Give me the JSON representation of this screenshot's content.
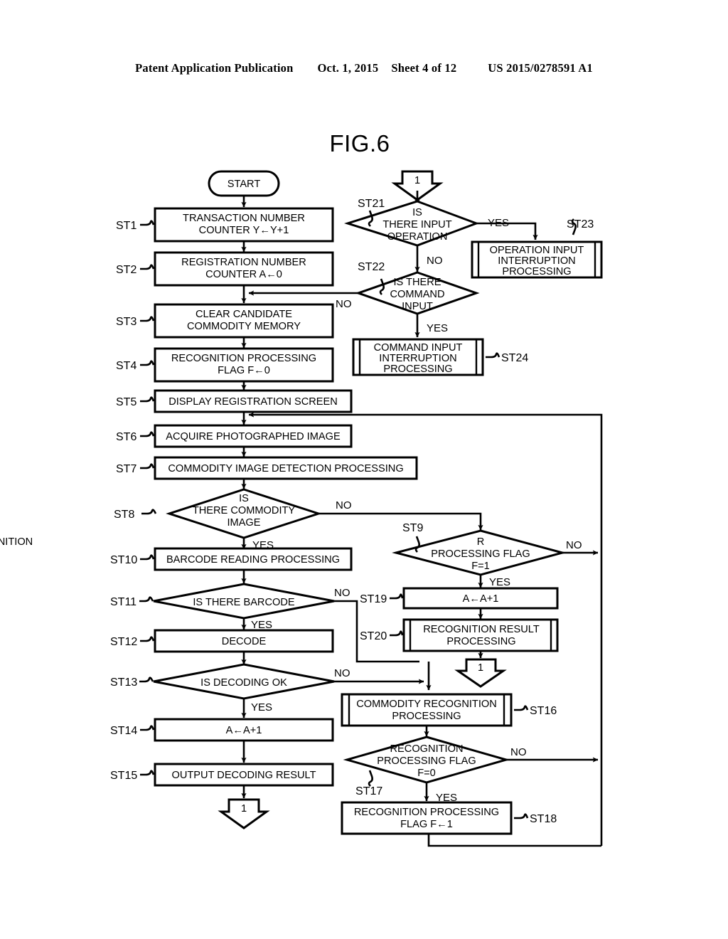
{
  "header": {
    "publication": "Patent Application Publication",
    "date": "Oct. 1, 2015",
    "sheet": "Sheet 4 of 12",
    "number": "US 2015/0278591 A1"
  },
  "figure": {
    "title": "FIG.6"
  },
  "nodes": {
    "start": "START",
    "st1": "TRANSACTION NUMBER\nCOUNTER Y←Y+1",
    "st1_l1": "TRANSACTION NUMBER",
    "st1_l2": "COUNTER Y←Y+1",
    "st2_l1": "REGISTRATION NUMBER",
    "st2_l2": "COUNTER A←0",
    "st3_l1": "CLEAR CANDIDATE",
    "st3_l2": "COMMODITY MEMORY",
    "st4_l1": "RECOGNITION PROCESSING",
    "st4_l2": "FLAG F←0",
    "st5": "DISPLAY REGISTRATION SCREEN",
    "st6": "ACQUIRE PHOTOGRAPHED IMAGE",
    "st7": "COMMODITY IMAGE DETECTION PROCESSING",
    "st8_l1": "IS",
    "st8_l2": "THERE COMMODITY",
    "st8_l3": "IMAGE",
    "st9_l1": "RECOGNITION",
    "st9_l2": "PROCESSING FLAG",
    "st9_l3": "F=1",
    "st10": "BARCODE READING PROCESSING",
    "st11": "IS THERE BARCODE",
    "st12": "DECODE",
    "st13": "IS DECODING OK",
    "st14": "A←A+1",
    "st15": "OUTPUT DECODING RESULT",
    "st16_l1": "COMMODITY RECOGNITION",
    "st16_l2": "PROCESSING",
    "st17_l1": "RECOGNITION",
    "st17_l2": "PROCESSING FLAG",
    "st17_l3": "F=0",
    "st18_l1": "RECOGNITION PROCESSING",
    "st18_l2": "FLAG F←1",
    "st19": "A←A+1",
    "st20_l1": "RECOGNITION RESULT",
    "st20_l2": "PROCESSING",
    "st21_l1": "IS",
    "st21_l2": "THERE INPUT",
    "st21_l3": "OPERATION",
    "st22_l1": "IS THERE",
    "st22_l2": "COMMAND",
    "st22_l3": "INPUT",
    "st23_l1": "OPERATION INPUT",
    "st23_l2": "INTERRUPTION",
    "st23_l3": "PROCESSING",
    "st24_l1": "COMMAND INPUT",
    "st24_l2": "INTERRUPTION",
    "st24_l3": "PROCESSING"
  },
  "step_labels": {
    "st1": "ST1",
    "st2": "ST2",
    "st3": "ST3",
    "st4": "ST4",
    "st5": "ST5",
    "st6": "ST6",
    "st7": "ST7",
    "st8": "ST8",
    "st9": "ST9",
    "st10": "ST10",
    "st11": "ST11",
    "st12": "ST12",
    "st13": "ST13",
    "st14": "ST14",
    "st15": "ST15",
    "st16": "ST16",
    "st17": "ST17",
    "st18": "ST18",
    "st19": "ST19",
    "st20": "ST20",
    "st21": "ST21",
    "st22": "ST22",
    "st23": "ST23",
    "st24": "ST24"
  },
  "edge_labels": {
    "st21_yes": "YES",
    "st21_no": "NO",
    "st22_no": "NO",
    "st22_yes": "YES",
    "st8_no": "NO",
    "st8_yes": "YES",
    "st9_no": "NO",
    "st9_yes": "YES",
    "st11_no": "NO",
    "st11_yes": "YES",
    "st13_no": "NO",
    "st13_yes": "YES",
    "st17_no": "NO",
    "st17_yes": "YES"
  },
  "connectors": {
    "c_top": "1",
    "c_st20": "1",
    "c_st15": "1"
  }
}
